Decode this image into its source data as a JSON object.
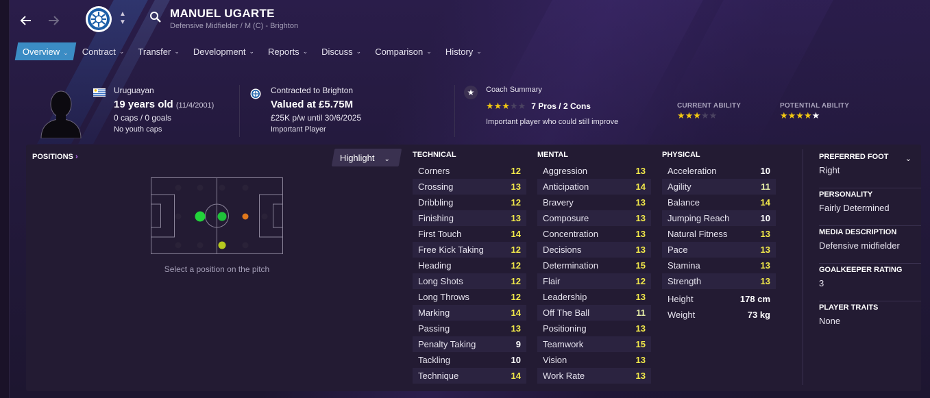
{
  "header": {
    "player_name": "MANUEL UGARTE",
    "subtitle": "Defensive Midfielder / M (C) - Brighton",
    "back_icon": "arrow-left-icon",
    "forward_icon": "arrow-right-icon",
    "search_icon": "search-icon",
    "colors": {
      "accent": "#3b8cc4",
      "background": "#1e1630"
    }
  },
  "tabs": [
    {
      "label": "Overview",
      "active": true
    },
    {
      "label": "Contract"
    },
    {
      "label": "Transfer"
    },
    {
      "label": "Development"
    },
    {
      "label": "Reports"
    },
    {
      "label": "Discuss"
    },
    {
      "label": "Comparison"
    },
    {
      "label": "History"
    }
  ],
  "summary": {
    "nationality": "Uruguayan",
    "age": "19 years old",
    "dob": "(11/4/2001)",
    "caps": "0 caps / 0 goals",
    "youth_caps": "No youth caps",
    "contract": "Contracted to Brighton",
    "value": "Valued at £5.75M",
    "wage": "£25K p/w until 30/6/2025",
    "squad_status": "Important Player",
    "coach_title": "Coach Summary",
    "coach_rating_stars": 3,
    "pros_cons": "7 Pros / 2 Cons",
    "coach_note": "Important player who could still improve",
    "current_ability_label": "CURRENT ABILITY",
    "current_ability_stars": 3,
    "potential_ability_label": "POTENTIAL ABILITY",
    "potential_ability_stars": 4.5
  },
  "positions": {
    "label": "POSITIONS",
    "highlight_label": "Highlight",
    "caption": "Select a position on the pitch"
  },
  "technical": {
    "title": "TECHNICAL",
    "attributes": [
      {
        "name": "Corners",
        "value": "12"
      },
      {
        "name": "Crossing",
        "value": "13"
      },
      {
        "name": "Dribbling",
        "value": "12"
      },
      {
        "name": "Finishing",
        "value": "13"
      },
      {
        "name": "First Touch",
        "value": "14"
      },
      {
        "name": "Free Kick Taking",
        "value": "12"
      },
      {
        "name": "Heading",
        "value": "12"
      },
      {
        "name": "Long Shots",
        "value": "12"
      },
      {
        "name": "Long Throws",
        "value": "12"
      },
      {
        "name": "Marking",
        "value": "14"
      },
      {
        "name": "Passing",
        "value": "13"
      },
      {
        "name": "Penalty Taking",
        "value": "9"
      },
      {
        "name": "Tackling",
        "value": "10"
      },
      {
        "name": "Technique",
        "value": "14"
      }
    ]
  },
  "mental": {
    "title": "MENTAL",
    "attributes": [
      {
        "name": "Aggression",
        "value": "13"
      },
      {
        "name": "Anticipation",
        "value": "14"
      },
      {
        "name": "Bravery",
        "value": "13"
      },
      {
        "name": "Composure",
        "value": "13"
      },
      {
        "name": "Concentration",
        "value": "13"
      },
      {
        "name": "Decisions",
        "value": "13"
      },
      {
        "name": "Determination",
        "value": "15"
      },
      {
        "name": "Flair",
        "value": "12"
      },
      {
        "name": "Leadership",
        "value": "13"
      },
      {
        "name": "Off The Ball",
        "value": "11"
      },
      {
        "name": "Positioning",
        "value": "13"
      },
      {
        "name": "Teamwork",
        "value": "15"
      },
      {
        "name": "Vision",
        "value": "13"
      },
      {
        "name": "Work Rate",
        "value": "13"
      }
    ]
  },
  "physical": {
    "title": "PHYSICAL",
    "attributes": [
      {
        "name": "Acceleration",
        "value": "10"
      },
      {
        "name": "Agility",
        "value": "11"
      },
      {
        "name": "Balance",
        "value": "14"
      },
      {
        "name": "Jumping Reach",
        "value": "10"
      },
      {
        "name": "Natural Fitness",
        "value": "13"
      },
      {
        "name": "Pace",
        "value": "13"
      },
      {
        "name": "Stamina",
        "value": "13"
      },
      {
        "name": "Strength",
        "value": "13"
      }
    ],
    "height_label": "Height",
    "height": "178 cm",
    "weight_label": "Weight",
    "weight": "73 kg"
  },
  "side": [
    {
      "label": "PREFERRED FOOT",
      "value": "Right"
    },
    {
      "label": "PERSONALITY",
      "value": "Fairly Determined"
    },
    {
      "label": "MEDIA DESCRIPTION",
      "value": "Defensive midfielder"
    },
    {
      "label": "GOALKEEPER RATING",
      "value": "3"
    },
    {
      "label": "PLAYER TRAITS",
      "value": "None"
    }
  ]
}
